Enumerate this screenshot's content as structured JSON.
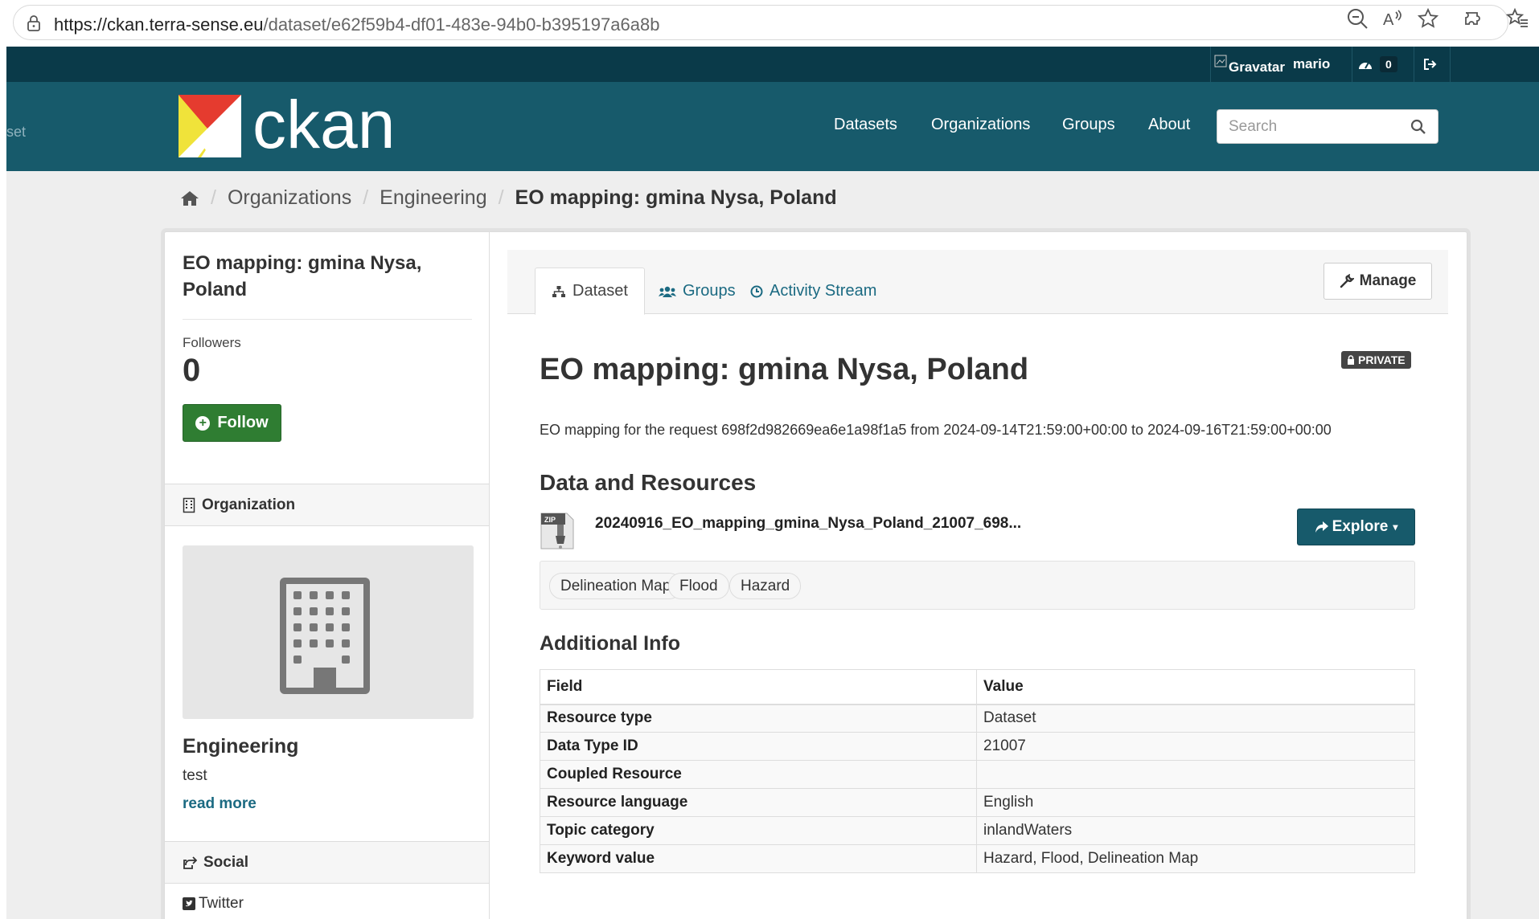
{
  "browser": {
    "url_host": "https://ckan.terra-sense.eu",
    "url_path": "/dataset/e62f59b4-df01-483e-94b0-b395197a6a8b"
  },
  "account": {
    "gravatar_alt": "Gravatar",
    "username": "mario",
    "dashboard_count": "0"
  },
  "masthead": {
    "partial_text": "set",
    "logo_text": "ckan",
    "nav": [
      "Datasets",
      "Organizations",
      "Groups",
      "About"
    ],
    "search_placeholder": "Search"
  },
  "breadcrumb": {
    "items": [
      "Organizations",
      "Engineering"
    ],
    "current": "EO mapping: gmina Nysa, Poland"
  },
  "sidebar": {
    "title": "EO mapping: gmina Nysa, Poland",
    "followers_label": "Followers",
    "followers_count": "0",
    "follow_label": "Follow",
    "organization_heading": "Organization",
    "org_name": "Engineering",
    "org_description": "test",
    "read_more": "read more",
    "social_heading": "Social",
    "twitter_label": "Twitter"
  },
  "tabs": {
    "dataset": "Dataset",
    "groups": "Groups",
    "activity": "Activity Stream",
    "manage": "Manage"
  },
  "dataset": {
    "private_label": "PRIVATE",
    "title": "EO mapping: gmina Nysa, Poland",
    "description": "EO mapping for the request 698f2d982669ea6e1a98f1a5 from 2024-09-14T21:59:00+00:00 to 2024-09-16T21:59:00+00:00",
    "resources_heading": "Data and Resources",
    "resource_format": "ZIP",
    "resource_name": "20240916_EO_mapping_gmina_Nysa_Poland_21007_698...",
    "explore_label": "Explore",
    "tags": [
      "Delineation Map",
      "Flood",
      "Hazard"
    ],
    "additional_info_heading": "Additional Info",
    "table_headers": [
      "Field",
      "Value"
    ],
    "table_rows": [
      [
        "Resource type",
        "Dataset"
      ],
      [
        "Data Type ID",
        "21007"
      ],
      [
        "Coupled Resource",
        ""
      ],
      [
        "Resource language",
        "English"
      ],
      [
        "Topic category",
        "inlandWaters"
      ],
      [
        "Keyword value",
        "Hazard, Flood, Delineation Map"
      ]
    ]
  },
  "colors": {
    "account_bar": "#0a3a49",
    "masthead": "#175a6b",
    "follow_green": "#2f7d32",
    "link": "#1b6a82"
  }
}
